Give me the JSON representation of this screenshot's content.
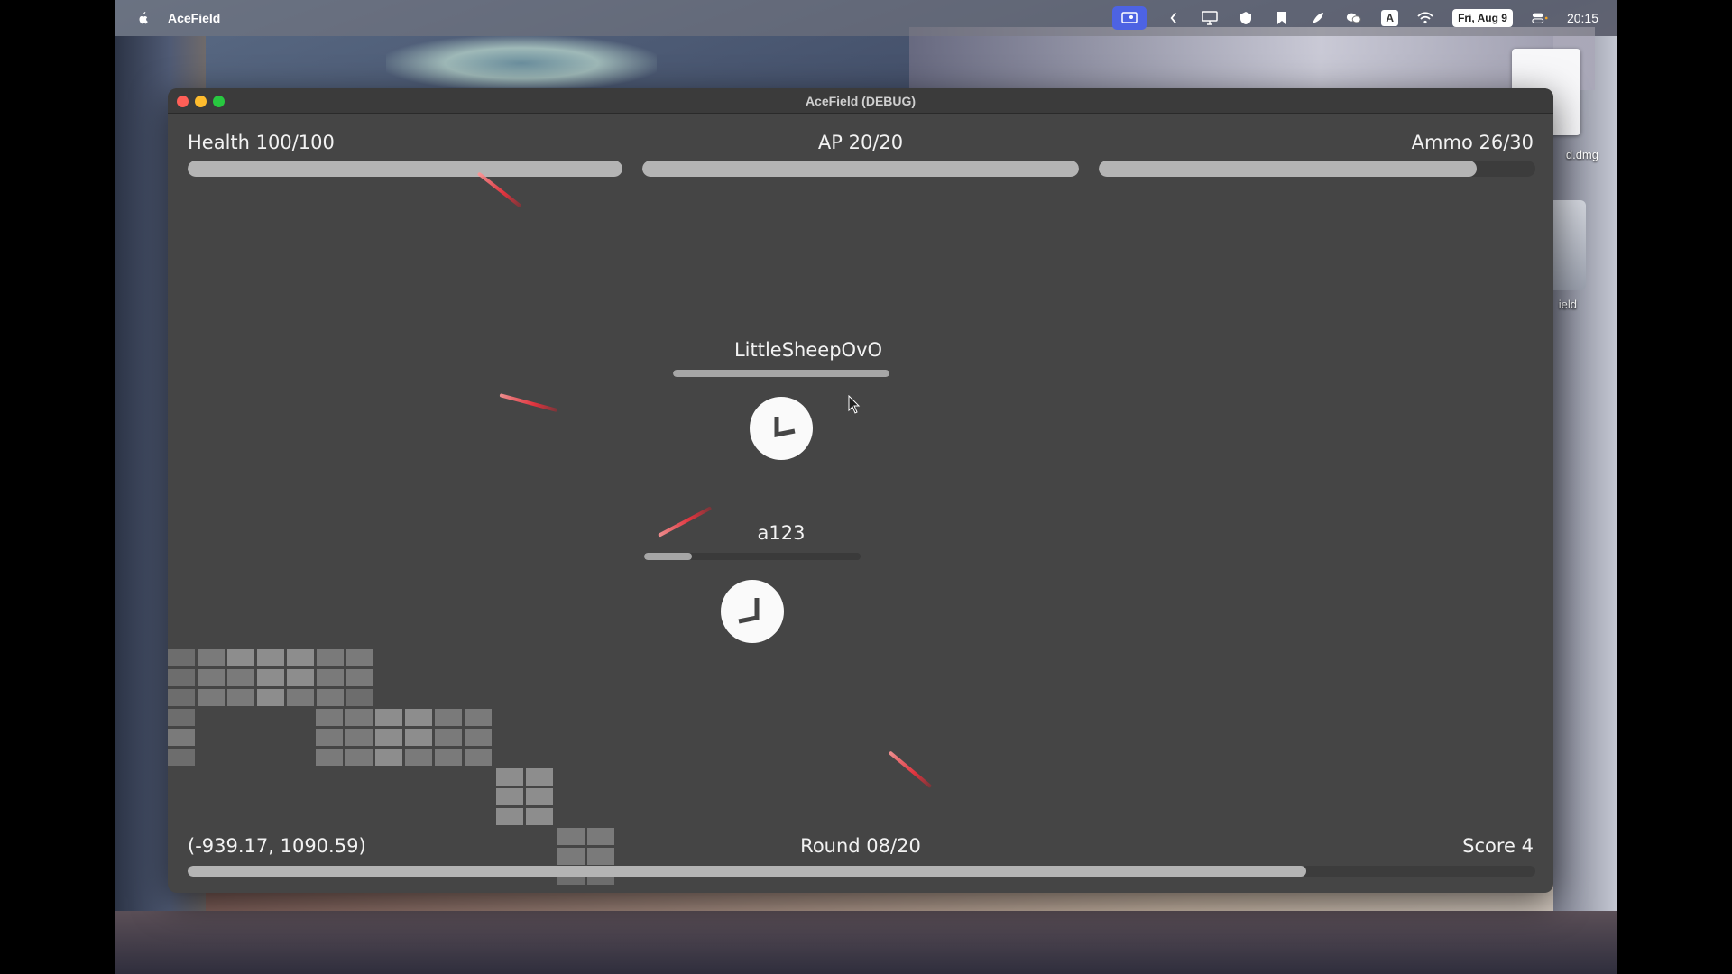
{
  "menubar": {
    "app_name": "AceField",
    "date": "Fri, Aug 9",
    "time": "20:15",
    "input_badge": "A"
  },
  "desktop": {
    "file_label": "d.dmg",
    "drive_label": "ield"
  },
  "window": {
    "title": "AceField (DEBUG)"
  },
  "hud": {
    "health_label": "Health 100/100",
    "health_fraction": 1.0,
    "ap_label": "AP 20/20",
    "ap_fraction": 1.0,
    "ammo_label": "Ammo 26/30",
    "ammo_fraction": 0.8667,
    "coords": "(-939.17, 1090.59)",
    "round_label": "Round 08/20",
    "round_fraction": 0.83,
    "score_label": "Score 4"
  },
  "players": [
    {
      "name": "LittleSheepOvO",
      "health_fraction": 1.0
    },
    {
      "name": "a123",
      "health_fraction": 0.22
    }
  ],
  "colors": {
    "game_bg": "#454545",
    "bar_fill": "#b4b4b4",
    "laser": "#e0343e"
  }
}
